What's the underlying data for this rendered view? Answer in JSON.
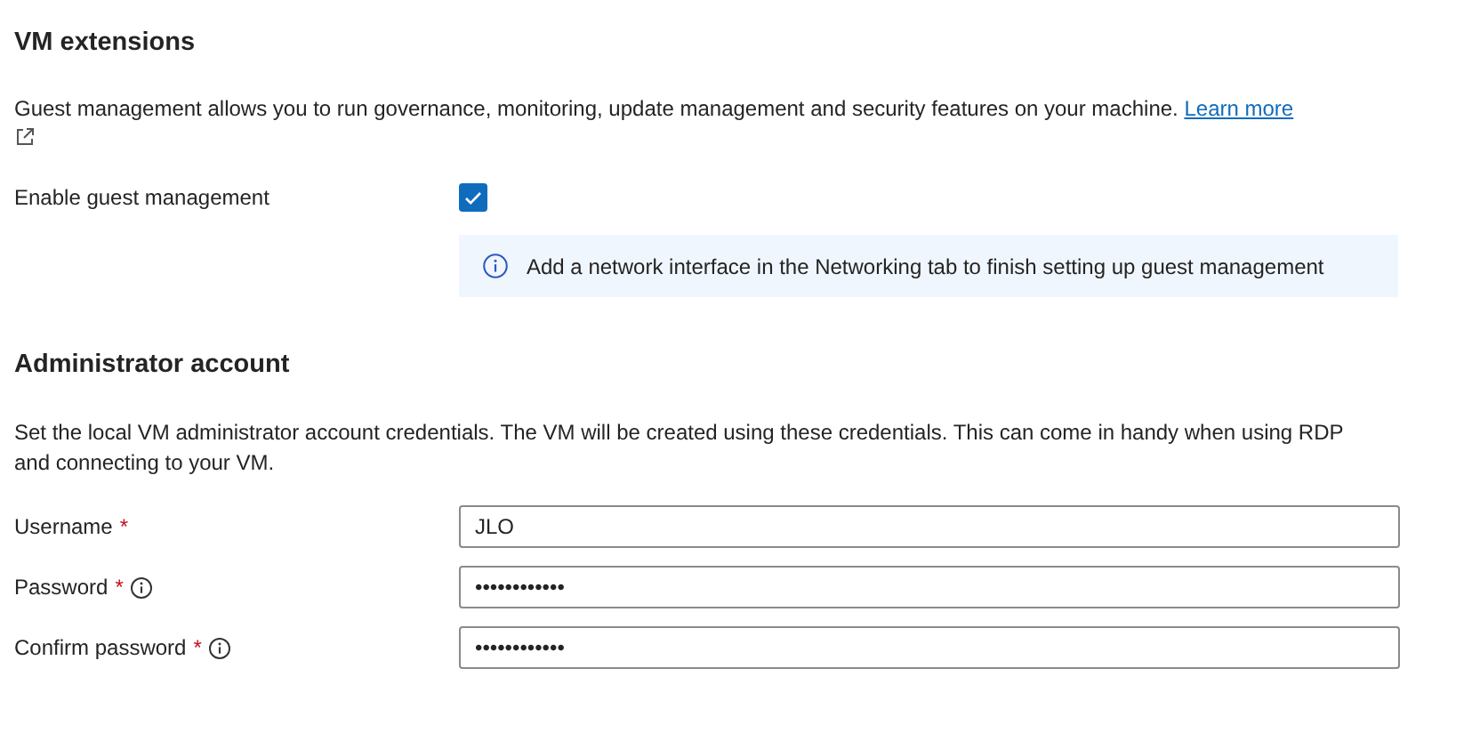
{
  "vm_extensions": {
    "title": "VM extensions",
    "description": "Guest management allows you to run governance, monitoring, update management and security features on your machine.",
    "link": "Learn more",
    "option": {
      "label": "Enable guest management",
      "checked": true
    },
    "info": "Add a network interface in the Networking tab to finish setting up guest management"
  },
  "administrator_account": {
    "title": "Administrator account",
    "description": "Set the local VM administrator account credentials. The VM will be created using these credentials. This can come in handy when using RDP and connecting to your VM.",
    "fields": [
      {
        "label": "Username",
        "required_mark": "*",
        "info": false,
        "value": "JLO"
      },
      {
        "label": "Password",
        "required_mark": "*",
        "info": true,
        "value": "••••••••••••"
      },
      {
        "label": "Confirm password",
        "required_mark": "*",
        "info": true,
        "value": "••••••••••••"
      }
    ]
  }
}
